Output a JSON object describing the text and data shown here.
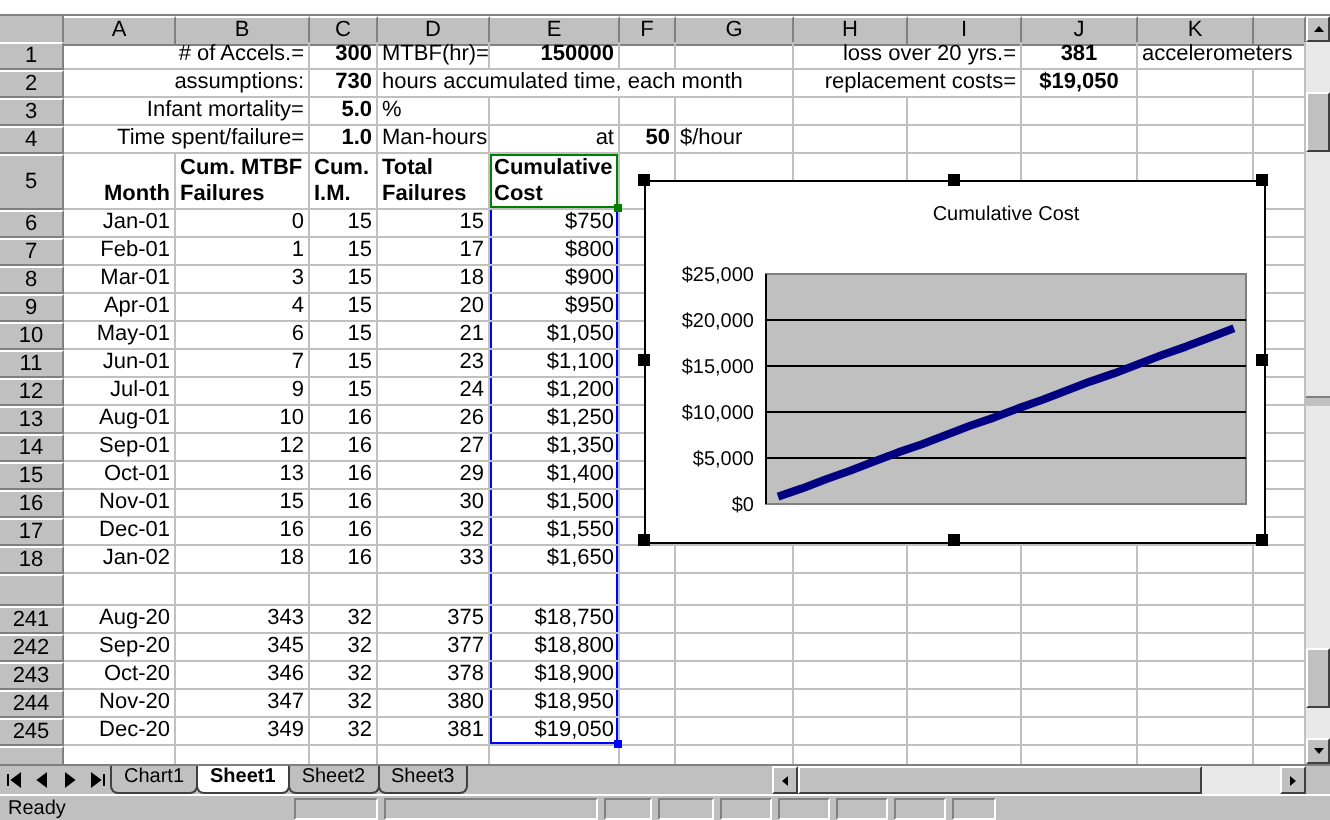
{
  "column_headers": [
    "A",
    "B",
    "C",
    "D",
    "E",
    "F",
    "G",
    "H",
    "I",
    "J",
    "K"
  ],
  "rows": [
    {
      "kind": "cells",
      "row": "1",
      "cells": [
        {
          "kind": "empty"
        },
        {
          "kind": "label",
          "text": "# of Accels.=",
          "bold": false
        },
        {
          "kind": "value",
          "text": "300",
          "bold": true
        },
        {
          "kind": "unit",
          "text": "MTBF(hr)=",
          "bold": false
        },
        {
          "kind": "value",
          "text": "150000",
          "bold": true
        },
        {
          "kind": "empty"
        },
        {
          "kind": "empty"
        },
        {
          "kind": "empty"
        },
        {
          "kind": "label",
          "text": "loss over 20 yrs.=",
          "bold": false
        },
        {
          "kind": "result",
          "text": "381",
          "bold": true
        },
        {
          "kind": "unit",
          "text": "accelerometers",
          "bold": false
        },
        {
          "kind": "empty"
        }
      ]
    },
    {
      "kind": "cells",
      "row": "2",
      "cells": [
        {
          "kind": "empty"
        },
        {
          "kind": "label",
          "text": "assumptions:",
          "bold": false
        },
        {
          "kind": "value",
          "text": "730",
          "bold": true
        },
        {
          "kind": "unit",
          "text": "hours accumulated time, each month",
          "bold": false
        },
        {
          "kind": "empty"
        },
        {
          "kind": "empty"
        },
        {
          "kind": "empty"
        },
        {
          "kind": "empty"
        },
        {
          "kind": "label",
          "text": "replacement costs=",
          "bold": false
        },
        {
          "kind": "result",
          "text": "$19,050",
          "bold": true
        },
        {
          "kind": "empty"
        },
        {
          "kind": "empty"
        }
      ]
    },
    {
      "kind": "cells",
      "row": "3",
      "cells": [
        {
          "kind": "empty"
        },
        {
          "kind": "label",
          "text": "Infant mortality=",
          "bold": false
        },
        {
          "kind": "value",
          "text": "5.0",
          "bold": true
        },
        {
          "kind": "unit",
          "text": "%",
          "bold": false
        },
        {
          "kind": "empty"
        },
        {
          "kind": "empty"
        },
        {
          "kind": "empty"
        },
        {
          "kind": "empty"
        },
        {
          "kind": "empty"
        },
        {
          "kind": "empty"
        },
        {
          "kind": "empty"
        },
        {
          "kind": "empty"
        }
      ]
    },
    {
      "kind": "cells",
      "row": "4",
      "cells": [
        {
          "kind": "empty"
        },
        {
          "kind": "label",
          "text": "Time spent/failure=",
          "bold": false
        },
        {
          "kind": "value",
          "text": "1.0",
          "bold": true
        },
        {
          "kind": "unit",
          "text": "Man-hours",
          "bold": false
        },
        {
          "kind": "label",
          "text": "at",
          "bold": false
        },
        {
          "kind": "value",
          "text": "50",
          "bold": true
        },
        {
          "kind": "unit",
          "text": "$/hour",
          "bold": false
        },
        {
          "kind": "empty"
        },
        {
          "kind": "empty"
        },
        {
          "kind": "empty"
        },
        {
          "kind": "empty"
        },
        {
          "kind": "empty"
        }
      ]
    },
    {
      "kind": "header",
      "row": "5",
      "cells": [
        {
          "kind": "label",
          "text": "Month",
          "bold": true,
          "active": false
        },
        {
          "kind": "heading",
          "text": "Cum. MTBF Failures",
          "bold": true,
          "active": false
        },
        {
          "kind": "heading",
          "text": "Cum. I.M.",
          "bold": true,
          "active": false
        },
        {
          "kind": "heading",
          "text": "Total Failures",
          "bold": true,
          "active": false
        },
        {
          "kind": "heading",
          "text": "Cumulative Cost",
          "bold": true,
          "active": true
        },
        {
          "kind": "empty"
        },
        {
          "kind": "empty"
        },
        {
          "kind": "empty"
        },
        {
          "kind": "empty"
        },
        {
          "kind": "empty"
        },
        {
          "kind": "empty"
        },
        {
          "kind": "empty"
        }
      ]
    },
    {
      "kind": "data",
      "row": "6",
      "values": [
        "Jan-01",
        "0",
        "15",
        "15",
        "$750"
      ],
      "in_range": true
    },
    {
      "kind": "data",
      "row": "7",
      "values": [
        "Feb-01",
        "1",
        "15",
        "17",
        "$800"
      ],
      "in_range": true
    },
    {
      "kind": "data",
      "row": "8",
      "values": [
        "Mar-01",
        "3",
        "15",
        "18",
        "$900"
      ],
      "in_range": true
    },
    {
      "kind": "data",
      "row": "9",
      "values": [
        "Apr-01",
        "4",
        "15",
        "20",
        "$950"
      ],
      "in_range": true
    },
    {
      "kind": "data",
      "row": "10",
      "values": [
        "May-01",
        "6",
        "15",
        "21",
        "$1,050"
      ],
      "in_range": true
    },
    {
      "kind": "data",
      "row": "11",
      "values": [
        "Jun-01",
        "7",
        "15",
        "23",
        "$1,100"
      ],
      "in_range": true
    },
    {
      "kind": "data",
      "row": "12",
      "values": [
        "Jul-01",
        "9",
        "15",
        "24",
        "$1,200"
      ],
      "in_range": true
    },
    {
      "kind": "data",
      "row": "13",
      "values": [
        "Aug-01",
        "10",
        "16",
        "26",
        "$1,250"
      ],
      "in_range": true
    },
    {
      "kind": "data",
      "row": "14",
      "values": [
        "Sep-01",
        "12",
        "16",
        "27",
        "$1,350"
      ],
      "in_range": true
    },
    {
      "kind": "data",
      "row": "15",
      "values": [
        "Oct-01",
        "13",
        "16",
        "29",
        "$1,400"
      ],
      "in_range": true
    },
    {
      "kind": "data",
      "row": "16",
      "values": [
        "Nov-01",
        "15",
        "16",
        "30",
        "$1,500"
      ],
      "in_range": true
    },
    {
      "kind": "data",
      "row": "17",
      "values": [
        "Dec-01",
        "16",
        "16",
        "32",
        "$1,550"
      ],
      "in_range": true
    },
    {
      "kind": "data",
      "row": "18",
      "values": [
        "Jan-02",
        "18",
        "16",
        "33",
        "$1,650"
      ],
      "in_range": true
    },
    {
      "kind": "cut",
      "in_range": true
    },
    {
      "kind": "data",
      "row": "241",
      "values": [
        "Aug-20",
        "343",
        "32",
        "375",
        "$18,750"
      ],
      "in_range": true
    },
    {
      "kind": "data",
      "row": "242",
      "values": [
        "Sep-20",
        "345",
        "32",
        "377",
        "$18,800"
      ],
      "in_range": true
    },
    {
      "kind": "data",
      "row": "243",
      "values": [
        "Oct-20",
        "346",
        "32",
        "378",
        "$18,900"
      ],
      "in_range": true
    },
    {
      "kind": "data",
      "row": "244",
      "values": [
        "Nov-20",
        "347",
        "32",
        "380",
        "$18,950"
      ],
      "in_range": true
    },
    {
      "kind": "data",
      "row": "245",
      "values": [
        "Dec-20",
        "349",
        "32",
        "381",
        "$19,050"
      ],
      "in_range": true
    },
    {
      "kind": "cut",
      "in_range": false
    }
  ],
  "chart": {
    "chart_data": {
      "type": "line",
      "title": "Cumulative Cost",
      "ylim": [
        0,
        25000
      ],
      "grid": true,
      "yticks": [
        {
          "value": 0,
          "label": "$0"
        },
        {
          "value": 5000,
          "label": "$5,000"
        },
        {
          "value": 10000,
          "label": "$10,000"
        },
        {
          "value": 15000,
          "label": "$15,000"
        },
        {
          "value": 20000,
          "label": "$20,000"
        },
        {
          "value": 25000,
          "label": "$25,000"
        }
      ],
      "series": [
        {
          "color": "#000080",
          "values": [
            800,
            1700,
            2700,
            3600,
            4600,
            5600,
            6500,
            7500,
            8500,
            9400,
            10400,
            11300,
            12300,
            13300,
            14200,
            15200,
            16200,
            17100,
            18100,
            19100
          ]
        }
      ]
    }
  },
  "sheet_tabs": [
    {
      "label": "Chart1",
      "selected": false
    },
    {
      "label": "Sheet1",
      "selected": true
    },
    {
      "label": "Sheet2",
      "selected": false
    },
    {
      "label": "Sheet3",
      "selected": false
    }
  ],
  "status_bar": {
    "text": "Ready"
  }
}
